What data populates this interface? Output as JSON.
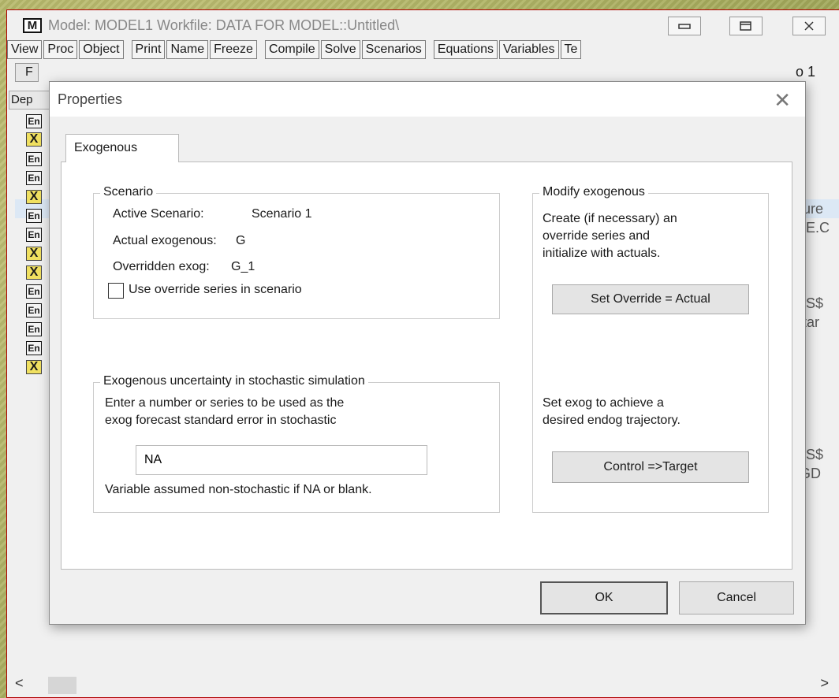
{
  "model_window": {
    "icon": "M",
    "title": "Model: MODEL1   Workfile: DATA FOR MODEL::Untitled\\",
    "toolbar": [
      "View",
      "Proc",
      "Object",
      "Print",
      "Name",
      "Freeze",
      "Compile",
      "Solve",
      "Scenarios",
      "Equations",
      "Variables",
      "Te"
    ],
    "partial_button": "F",
    "scenario_fragment": "o 1",
    "column_header_fragment": "Dep",
    "list_badges": [
      "En",
      "X",
      "En",
      "En",
      "X",
      "En",
      "En",
      "X",
      "X",
      "En",
      "En",
      "En",
      "En",
      "X"
    ],
    "right_fragments": [
      "iture",
      "NE.C",
      "US$",
      "star",
      "US$",
      ".GD"
    ]
  },
  "dialog": {
    "title": "Properties",
    "tab": "Exogenous",
    "scenario": {
      "label": "Scenario",
      "active_label": "Active Scenario:",
      "active_value": "Scenario 1",
      "actual_label": "Actual exogenous:",
      "actual_value": "G",
      "overridden_label": "Overridden exog:",
      "overridden_value": "G_1",
      "checkbox_label": "Use override series in scenario",
      "checkbox_checked": false
    },
    "uncertainty": {
      "label": "Exogenous uncertainty in stochastic simulation",
      "line1": "Enter a number or series to be used as the",
      "line2": "exog forecast standard error in stochastic",
      "value": "NA",
      "note": "Variable assumed non-stochastic if NA or blank."
    },
    "modify": {
      "label": "Modify exogenous",
      "desc1": "Create (if necessary) an",
      "desc2": "override series and",
      "desc3": "initialize with actuals.",
      "set_override_button": "Set Override = Actual",
      "desc4": "Set exog to achieve a",
      "desc5": "desired endog trajectory.",
      "control_button": "Control =>Target"
    },
    "ok_button": "OK",
    "cancel_button": "Cancel"
  }
}
